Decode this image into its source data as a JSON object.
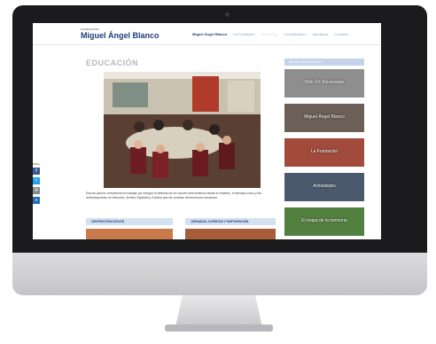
{
  "site": {
    "logo_small": "FUNDACIÓN",
    "logo": "Miguel Ángel Blanco",
    "nav": [
      "Miguel Ángel Blanco",
      "La Fundación",
      "Educación",
      "Comunicación",
      "Ayúdanos",
      "Contacto"
    ]
  },
  "page": {
    "title": "EDUCACIÓN",
    "intro": "Educar para la convivencia es trabajar por integrar la defensa de los valores democráticos desde el realismo, el ejemplo cívico y las reivindicaciones de Memoria, Verdad, Dignidad y Justicia que las víctimas del terrorismo encarnan."
  },
  "sections": [
    {
      "label": "CENTROS EDUCATIVOS"
    },
    {
      "label": "JORNADAS, JUVENTUD Y PARTICIPACIÓN"
    }
  ],
  "share": {
    "label": "Share",
    "buttons": [
      {
        "icon": "facebook-icon",
        "glyph": "f",
        "color": "#3b5998"
      },
      {
        "icon": "twitter-icon",
        "glyph": "t",
        "color": "#1da1f2"
      },
      {
        "icon": "email-icon",
        "glyph": "✉",
        "color": "#7f8c8d"
      },
      {
        "icon": "share-icon",
        "glyph": "+",
        "color": "#2b6cb0"
      }
    ]
  },
  "sidebar": {
    "title": "MIGUEL ÁNGEL BLANCO",
    "cards": [
      {
        "label": "Web XX Aniversario",
        "color": "#8e8e8e"
      },
      {
        "label": "Miguel Ángel Blanco",
        "color": "#6b5f58"
      },
      {
        "label": "La Fundación",
        "color": "#a24b3c"
      },
      {
        "label": "Actividades",
        "color": "#4a5a6c"
      },
      {
        "label": "El mapa de la memoria",
        "color": "#52803f"
      }
    ]
  }
}
